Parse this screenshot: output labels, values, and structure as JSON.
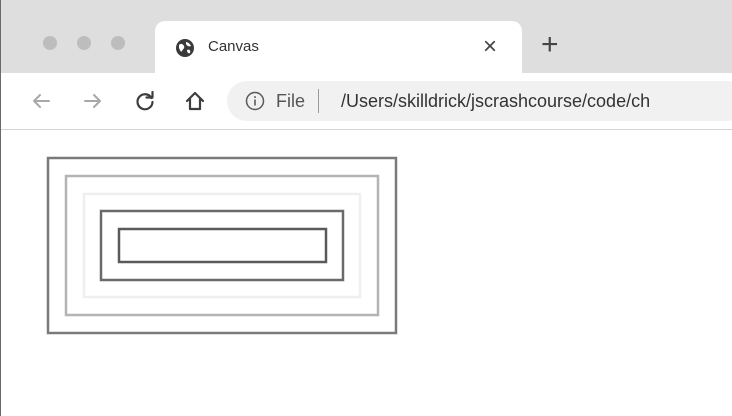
{
  "window": {
    "controls": [
      {
        "name": "close-window-button",
        "color": "#bdbdbd"
      },
      {
        "name": "minimize-window-button",
        "color": "#bdbdbd"
      },
      {
        "name": "maximize-window-button",
        "color": "#bdbdbd"
      }
    ]
  },
  "tab": {
    "icon": "globe-icon",
    "title": "Canvas",
    "close_label": "×"
  },
  "new_tab_label": "+",
  "toolbar": {
    "back_icon": "arrow-left-icon",
    "forward_icon": "arrow-right-icon",
    "reload_icon": "reload-icon",
    "home_icon": "home-icon",
    "info_icon": "info-icon",
    "scheme_label": "File",
    "url": "/Users/skilldrick/jscrashcourse/code/ch"
  },
  "canvas": {
    "stroke_colors": [
      "#7a7a7a",
      "#b4b4b4",
      "#efefef",
      "#6a6a6a",
      "#5a5a5a"
    ]
  }
}
